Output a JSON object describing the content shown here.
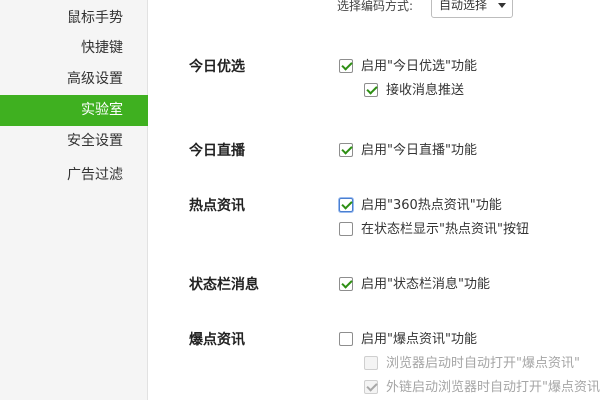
{
  "sidebar": {
    "items": [
      {
        "label": "鼠标手势",
        "active": false
      },
      {
        "label": "快捷键",
        "active": false
      },
      {
        "label": "高级设置",
        "active": false
      },
      {
        "label": "实验室",
        "active": true
      },
      {
        "label": "安全设置",
        "active": false
      },
      {
        "label": "广告过滤",
        "active": false
      }
    ]
  },
  "encoding": {
    "label": "选择编码方式:",
    "selected": "自动选择"
  },
  "sections": [
    {
      "title": "今日优选",
      "options": [
        {
          "label": "启用\"今日优选\"功能",
          "checked": true
        },
        {
          "label": "接收消息推送",
          "checked": true
        }
      ]
    },
    {
      "title": "今日直播",
      "options": [
        {
          "label": "启用\"今日直播\"功能",
          "checked": true
        }
      ]
    },
    {
      "title": "热点资讯",
      "options": [
        {
          "label": "启用\"360热点资讯\"功能",
          "checked": true
        },
        {
          "label": "在状态栏显示\"热点资讯\"按钮",
          "checked": false
        }
      ]
    },
    {
      "title": "状态栏消息",
      "options": [
        {
          "label": "启用\"状态栏消息\"功能",
          "checked": true
        }
      ]
    },
    {
      "title": "爆点资讯",
      "options": [
        {
          "label": "启用\"爆点资讯\"功能",
          "checked": false
        },
        {
          "label": "浏览器启动时自动打开\"爆点资讯\"",
          "checked": false,
          "disabled": true
        },
        {
          "label": "外链启动浏览器时自动打开\"爆点资讯",
          "checked": true,
          "disabled": true
        }
      ]
    }
  ],
  "colors": {
    "accent": "#3fb020",
    "check": "#2e8f14"
  }
}
